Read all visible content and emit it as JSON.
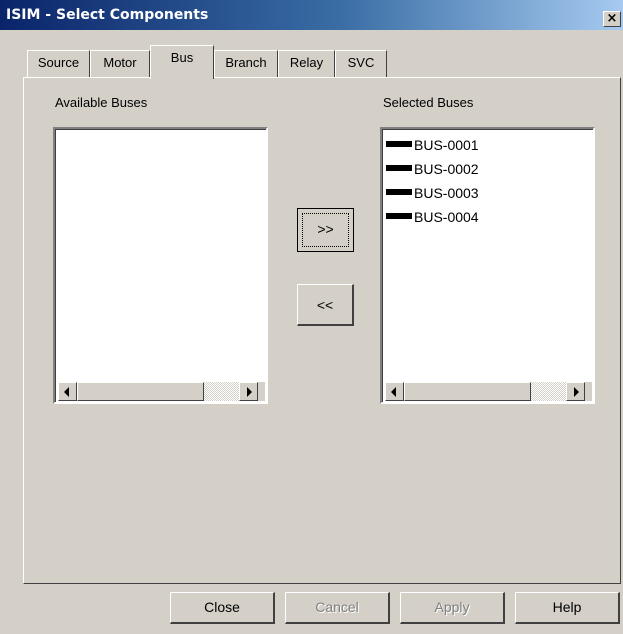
{
  "window": {
    "title": "ISIM - Select Components",
    "close_glyph": "×"
  },
  "tabs": [
    {
      "label": "Source",
      "active": false
    },
    {
      "label": "Motor",
      "active": false
    },
    {
      "label": "Bus",
      "active": true
    },
    {
      "label": "Branch",
      "active": false
    },
    {
      "label": "Relay",
      "active": false
    },
    {
      "label": "SVC",
      "active": false
    }
  ],
  "available": {
    "label": "Available Buses",
    "items": []
  },
  "selected": {
    "label": "Selected Buses",
    "items": [
      "BUS-0001",
      "BUS-0002",
      "BUS-0003",
      "BUS-0004"
    ],
    "swatch_color": "#000000"
  },
  "transfer": {
    "add_label": ">>",
    "remove_label": "<<"
  },
  "footer": {
    "close_label": "Close",
    "cancel_label": "Cancel",
    "apply_label": "Apply",
    "help_label": "Help"
  },
  "colors": {
    "title_bar_start": "#0a246a",
    "title_bar_end": "#a6caf0",
    "face": "#d4d0c8"
  }
}
